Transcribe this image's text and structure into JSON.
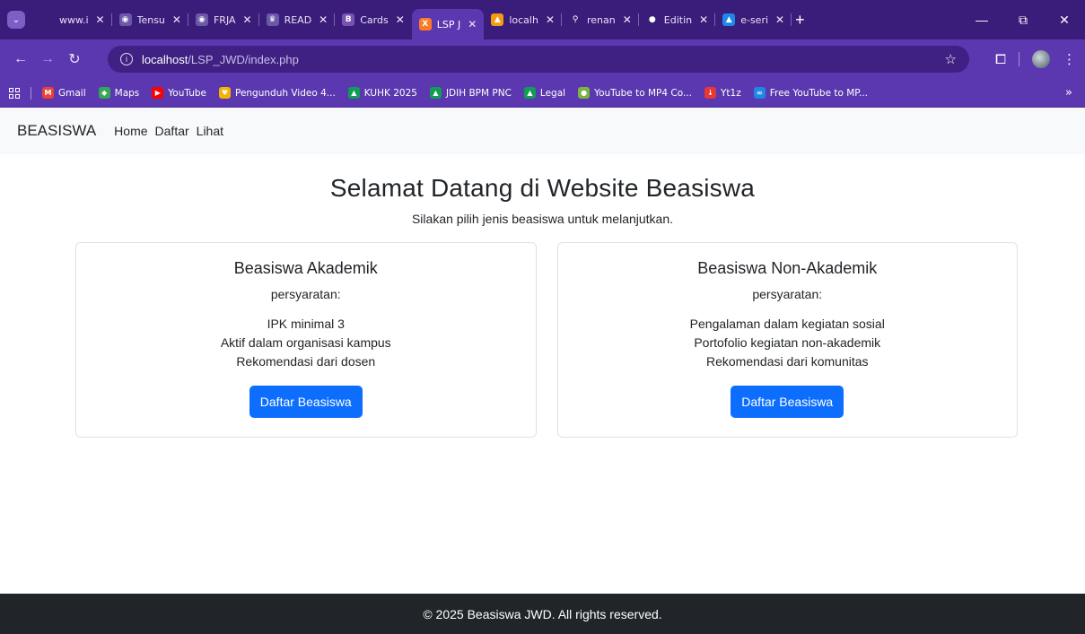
{
  "browser": {
    "tabs": [
      {
        "label": "www.i",
        "icon": "globe-icon",
        "icon_color": "#3a1d7a",
        "icon_glyph": ""
      },
      {
        "label": "Tensu",
        "icon": "globe-icon",
        "icon_color": "#6b58a8",
        "icon_glyph": "◉"
      },
      {
        "label": "FRJA",
        "icon": "globe-icon",
        "icon_color": "#6b58a8",
        "icon_glyph": "◉"
      },
      {
        "label": "READ",
        "icon": "crown-icon",
        "icon_color": "#6b58a8",
        "icon_glyph": "♛"
      },
      {
        "label": "Cards",
        "icon": "bootstrap-icon",
        "icon_color": "#7952b3",
        "icon_glyph": "B"
      },
      {
        "label": "LSP J",
        "icon": "xampp-icon",
        "icon_color": "#fb7a24",
        "icon_glyph": "X",
        "active": true
      },
      {
        "label": "localh",
        "icon": "phpmyadmin-icon",
        "icon_color": "#f39c12",
        "icon_glyph": "▲"
      },
      {
        "label": "renan",
        "icon": "search-icon",
        "icon_color": "#3a1d7a",
        "icon_glyph": "⚲"
      },
      {
        "label": "Editin",
        "icon": "github-icon",
        "icon_color": "#3a1d7a",
        "icon_glyph": "●"
      },
      {
        "label": "e-seri",
        "icon": "drive-icon",
        "icon_color": "#1e88e5",
        "icon_glyph": "▲"
      }
    ],
    "tab_close": "✕",
    "new_tab": "+",
    "window_controls": {
      "minimize": "—",
      "restore": "⧉",
      "close": "✕"
    },
    "address": {
      "host": "localhost",
      "path": "/LSP_JWD/index.php"
    },
    "bookmarks": [
      {
        "label": "Gmail",
        "icon": "gmail-icon",
        "icon_color": "#ea4335",
        "icon_glyph": "M"
      },
      {
        "label": "Maps",
        "icon": "maps-icon",
        "icon_color": "#34a853",
        "icon_glyph": "◆"
      },
      {
        "label": "YouTube",
        "icon": "youtube-icon",
        "icon_color": "#ff0000",
        "icon_glyph": "▶"
      },
      {
        "label": "Pengunduh Video 4...",
        "icon": "heart-icon",
        "icon_color": "#f4b400",
        "icon_glyph": "♥"
      },
      {
        "label": "KUHK 2025",
        "icon": "drive-icon",
        "icon_color": "#0f9d58",
        "icon_glyph": "▲"
      },
      {
        "label": "JDIH BPM PNC",
        "icon": "drive-icon",
        "icon_color": "#0f9d58",
        "icon_glyph": "▲"
      },
      {
        "label": "Legal",
        "icon": "drive-icon",
        "icon_color": "#0f9d58",
        "icon_glyph": "▲"
      },
      {
        "label": "YouTube to MP4 Co...",
        "icon": "bird-icon",
        "icon_color": "#7cb342",
        "icon_glyph": "●"
      },
      {
        "label": "Yt1z",
        "icon": "download-icon",
        "icon_color": "#e53935",
        "icon_glyph": "↓"
      },
      {
        "label": "Free YouTube to MP...",
        "icon": "infinity-icon",
        "icon_color": "#1e88e5",
        "icon_glyph": "∞"
      }
    ],
    "bookmarks_more": "»"
  },
  "navbar": {
    "brand": "BEASISWA",
    "links": [
      "Home",
      "Daftar",
      "Lihat"
    ]
  },
  "hero": {
    "title": "Selamat Datang di Website Beasiswa",
    "subtitle": "Silakan pilih jenis beasiswa untuk melanjutkan."
  },
  "cards": [
    {
      "title": "Beasiswa Akademik",
      "req_title": "persyaratan:",
      "requirements": [
        "IPK minimal 3",
        "Aktif dalam organisasi kampus",
        "Rekomendasi dari dosen"
      ],
      "button": "Daftar Beasiswa"
    },
    {
      "title": "Beasiswa Non-Akademik",
      "req_title": "persyaratan:",
      "requirements": [
        "Pengalaman dalam kegiatan sosial",
        "Portofolio kegiatan non-akademik",
        "Rekomendasi dari komunitas"
      ],
      "button": "Daftar Beasiswa"
    }
  ],
  "footer": {
    "text": "© 2025 Beasiswa JWD. All rights reserved."
  },
  "colors": {
    "primary_button": "#0d6efd",
    "footer_bg": "#212529",
    "browser_theme": "#5b37b0"
  }
}
